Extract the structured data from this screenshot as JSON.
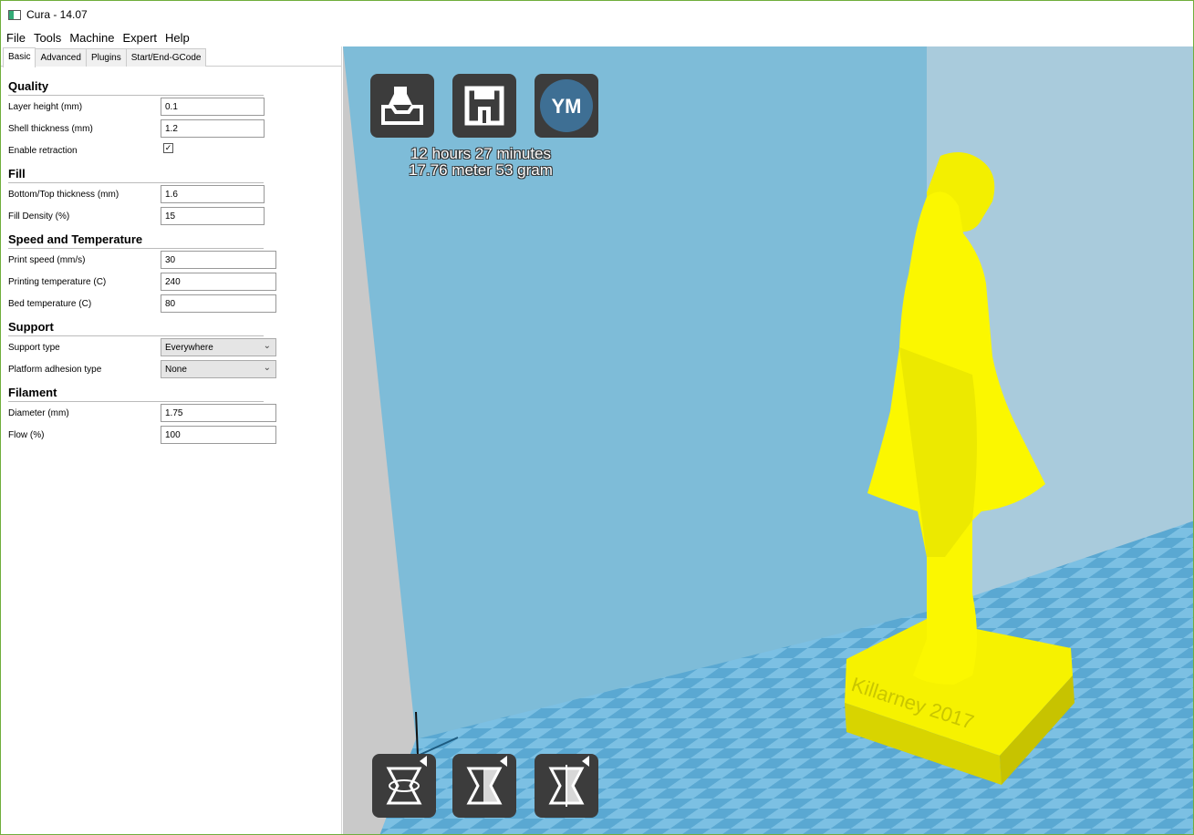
{
  "window": {
    "title": "Cura - 14.07"
  },
  "menu": [
    "File",
    "Tools",
    "Machine",
    "Expert",
    "Help"
  ],
  "tabs": [
    "Basic",
    "Advanced",
    "Plugins",
    "Start/End-GCode"
  ],
  "sections": {
    "quality": {
      "title": "Quality",
      "layer_height": {
        "label": "Layer height (mm)",
        "value": "0.1"
      },
      "shell_thickness": {
        "label": "Shell thickness (mm)",
        "value": "1.2"
      },
      "enable_retraction": {
        "label": "Enable retraction",
        "checked": true
      }
    },
    "fill": {
      "title": "Fill",
      "bottom_top": {
        "label": "Bottom/Top thickness (mm)",
        "value": "1.6"
      },
      "density": {
        "label": "Fill Density (%)",
        "value": "15"
      }
    },
    "speed": {
      "title": "Speed and Temperature",
      "print_speed": {
        "label": "Print speed (mm/s)",
        "value": "30"
      },
      "print_temp": {
        "label": "Printing temperature (C)",
        "value": "240"
      },
      "bed_temp": {
        "label": "Bed temperature (C)",
        "value": "80"
      }
    },
    "support": {
      "title": "Support",
      "support_type": {
        "label": "Support type",
        "value": "Everywhere"
      },
      "adhesion": {
        "label": "Platform adhesion type",
        "value": "None"
      }
    },
    "filament": {
      "title": "Filament",
      "diameter": {
        "label": "Diameter (mm)",
        "value": "1.75"
      },
      "flow": {
        "label": "Flow (%)",
        "value": "100"
      }
    }
  },
  "viewer": {
    "print_time": "12 hours 27 minutes",
    "print_material": "17.76 meter 53 gram",
    "avatar_initials": "YM",
    "model_base_text": "Killarney 2017",
    "icons": [
      "load-model-icon",
      "save-gcode-icon",
      "rotate-icon",
      "scale-icon",
      "mirror-icon"
    ],
    "colors": {
      "background": "#7ab7d3",
      "model": "#ffff00",
      "avatar": "#3e6f94",
      "tool_button": "#3c3c3c"
    }
  }
}
